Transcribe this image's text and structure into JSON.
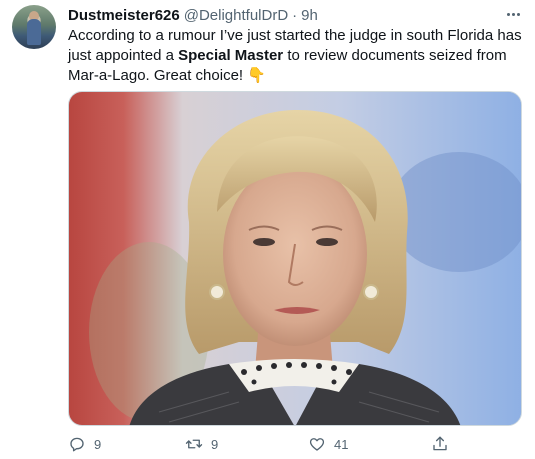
{
  "tweet": {
    "display_name": "Dustmeister626",
    "handle": "@DelightfulDrD",
    "separator": "·",
    "time": "9h",
    "text_part1": "According to a rumour I’ve just started the judge in south Florida has just appointed a ",
    "text_bold": "Special Master",
    "text_part2": " to review documents seized from Mar-a-Lago. Great choice! ",
    "emoji": "👇",
    "media_alt": "Photo of a woman with short blonde hair wearing pearl earrings"
  },
  "actions": {
    "reply_count": "9",
    "retweet_count": "9",
    "like_count": "41"
  },
  "icons": {
    "avatar": "user-avatar",
    "more": "more-options-icon",
    "reply": "reply-icon",
    "retweet": "retweet-icon",
    "like": "heart-icon",
    "share": "share-icon"
  },
  "colors": {
    "text": "#0f1419",
    "secondary": "#536471",
    "border": "#cfd9de"
  }
}
